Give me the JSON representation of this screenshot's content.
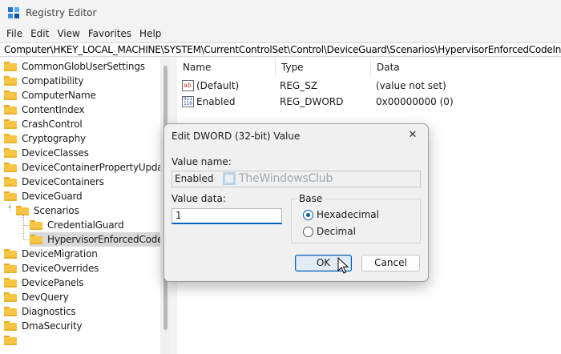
{
  "window": {
    "title": "Registry Editor"
  },
  "menu": [
    "File",
    "Edit",
    "View",
    "Favorites",
    "Help"
  ],
  "address": "Computer\\HKEY_LOCAL_MACHINE\\SYSTEM\\CurrentControlSet\\Control\\DeviceGuard\\Scenarios\\HypervisorEnforcedCodeIntegrity",
  "tree": {
    "items": [
      "CommonGlobUserSettings",
      "Compatibility",
      "ComputerName",
      "ContentIndex",
      "CrashControl",
      "Cryptography",
      "DeviceClasses",
      "DeviceContainerPropertyUpdate",
      "DeviceContainers",
      "DeviceGuard",
      "Scenarios",
      "CredentialGuard",
      "HypervisorEnforcedCodeIr",
      "DeviceMigration",
      "DeviceOverrides",
      "DevicePanels",
      "DevQuery",
      "Diagnostics",
      "DmaSecurity"
    ],
    "expanded_chevron": "˅"
  },
  "list": {
    "columns": [
      "Name",
      "Type",
      "Data"
    ],
    "rows": [
      {
        "name": "(Default)",
        "type": "REG_SZ",
        "data": "(value not set)",
        "icon": "ab"
      },
      {
        "name": "Enabled",
        "type": "REG_DWORD",
        "data": "0x00000000 (0)",
        "icon": "011 110"
      }
    ]
  },
  "dialog": {
    "title": "Edit DWORD (32-bit) Value",
    "close": "✕",
    "value_name_label": "Value name:",
    "value_name": "Enabled",
    "value_data_label": "Value data:",
    "value_data": "1",
    "base_label": "Base",
    "base_options": [
      "Hexadecimal",
      "Decimal"
    ],
    "selected_base": "Hexadecimal",
    "ok_label": "OK",
    "cancel_label": "Cancel"
  },
  "watermark": "TheWindowsClub",
  "colors": {
    "accent": "#005fb8",
    "folder": "#f7c544",
    "selection": "#d9d9d9"
  }
}
